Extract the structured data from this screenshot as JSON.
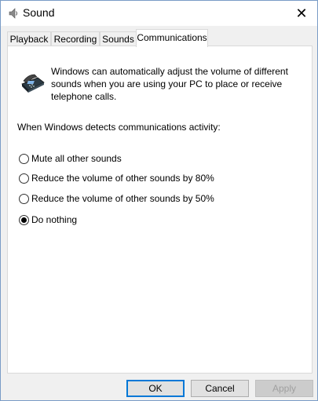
{
  "window": {
    "title": "Sound",
    "close_glyph": "✕",
    "title_icon": "speaker-icon"
  },
  "tabs": [
    {
      "label": "Playback",
      "active": false
    },
    {
      "label": "Recording",
      "active": false
    },
    {
      "label": "Sounds",
      "active": false
    },
    {
      "label": "Communications",
      "active": true
    }
  ],
  "panel": {
    "icon": "telephone-icon",
    "description": "Windows can automatically adjust the volume of different sounds when you are using your PC to place or receive telephone calls.",
    "prompt": "When Windows detects communications activity:",
    "options": [
      {
        "label": "Mute all other sounds",
        "checked": false
      },
      {
        "label": "Reduce the volume of other sounds by 80%",
        "checked": false
      },
      {
        "label": "Reduce the volume of other sounds by 50%",
        "checked": false
      },
      {
        "label": "Do nothing",
        "checked": true
      }
    ]
  },
  "buttons": {
    "ok": "OK",
    "cancel": "Cancel",
    "apply": "Apply"
  },
  "colors": {
    "accent": "#0078d7",
    "window_border": "#7a9cc6"
  }
}
